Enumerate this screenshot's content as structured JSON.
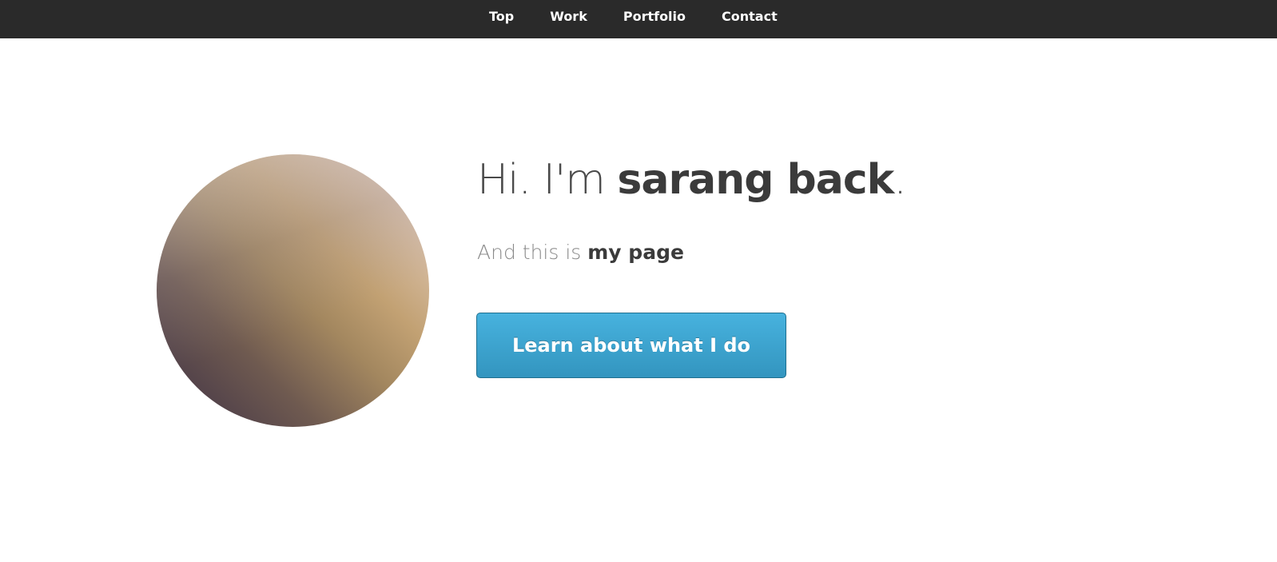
{
  "nav": {
    "items": [
      {
        "label": "Top"
      },
      {
        "label": "Work"
      },
      {
        "label": "Portfolio"
      },
      {
        "label": "Contact"
      }
    ]
  },
  "hero": {
    "greeting_prefix": "Hi. I'm ",
    "name": "sarang back",
    "greeting_suffix": ".",
    "sub_prefix": "And this is ",
    "sub_strong": "my page",
    "cta_label": "Learn about what I do"
  },
  "colors": {
    "nav_background": "#2a2a2a",
    "cta_blue": "#3ba3d0",
    "text_dark": "#3b3b3b"
  }
}
